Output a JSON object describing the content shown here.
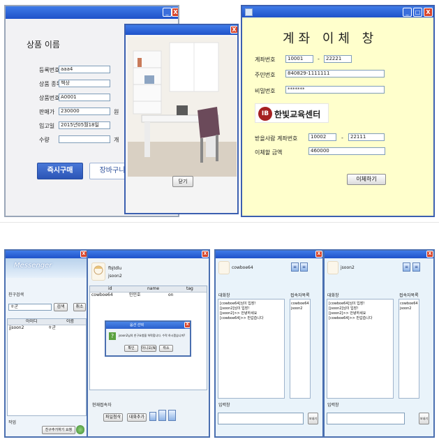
{
  "product": {
    "heading": "상품 이름",
    "fields": [
      {
        "label": "등록번호",
        "value": "aaa4"
      },
      {
        "label": "상품 종목",
        "value": "책상"
      },
      {
        "label": "상품번호",
        "value": "A0001"
      },
      {
        "label": "판매가",
        "value": "230000",
        "suffix": "원"
      },
      {
        "label": "입고일",
        "value": "2015년05월18일"
      },
      {
        "label": "수량",
        "value": "",
        "suffix": "개"
      }
    ],
    "buy_now": "즉시구매",
    "cart": "장바구니"
  },
  "image_popup": {
    "close_label": "닫기"
  },
  "transfer": {
    "title": "계좌 이체 창",
    "account_label": "계좌번호",
    "account_part1": "10001",
    "account_sep": "-",
    "account_part2": "22221",
    "resident_label": "주민번호",
    "resident_value": "840829-1111111",
    "password_label": "비밀번호",
    "password_value": "*******",
    "logo_text": "한빛교육센터",
    "logo_mark": "IB",
    "recipient_label": "받을사람 계좌번호",
    "recipient_part1": "10002",
    "recipient_sep": "-",
    "recipient_part2": "22111",
    "amount_label": "이체할 금액",
    "amount_value": "460000",
    "submit": "이체하기"
  },
  "messenger": {
    "header": "Messenger",
    "search_title": "친구검색",
    "search_value": "ㅎ군",
    "search_btn": "검색",
    "cancel_btn": "취소",
    "col_id": "아이디",
    "col_name": "이름",
    "row_id": "jjsoon2",
    "row_name": "ㅎ군",
    "bottom_label": "작업",
    "add_friend_btn": "친구추가하기 요청",
    "profile_id": "fbjtdlu",
    "profile_name": "jsoon2",
    "table_headers": [
      "id",
      "name",
      "tag"
    ],
    "table_row": [
      "cowboe64",
      "민민호",
      "on"
    ],
    "dialog_title": "옵션 선택",
    "dialog_msg": "jsoon2님의 친구요청을 허락합니다. 수락 하시겠습니까?",
    "dialog_btns": [
      "확인",
      "아니오(N)",
      "취소"
    ],
    "online_label": "현재접속자",
    "bottom_btns": [
      "파일첨삭",
      "대화추가"
    ]
  },
  "chat_left": {
    "user": "cowboe64",
    "chat_label": "대화창",
    "friends_label": "접속자목록",
    "messages": [
      "[cowboe64]님이 입장!",
      "[jsoon2]님이 입장!",
      "[jsoon2]>> 안녕하세요",
      "[cowboe64]>> 반갑습니다"
    ],
    "friends": [
      "cowboe64",
      "jsoon2"
    ],
    "input_label": "입력창",
    "send_btn": "보내기"
  },
  "chat_right": {
    "user": "jsoon2",
    "chat_label": "대화창",
    "friends_label": "접속자목록",
    "messages": [
      "[cowboe64]님이 입장!",
      "[jsoon2]님이 입장!",
      "[jsoon2]>> 안녕하세요",
      "[cowboe64]>> 반갑습니다"
    ],
    "friends": [
      "cowboe64",
      "jsoon2"
    ],
    "input_label": "입력창",
    "send_btn": "보내기"
  }
}
